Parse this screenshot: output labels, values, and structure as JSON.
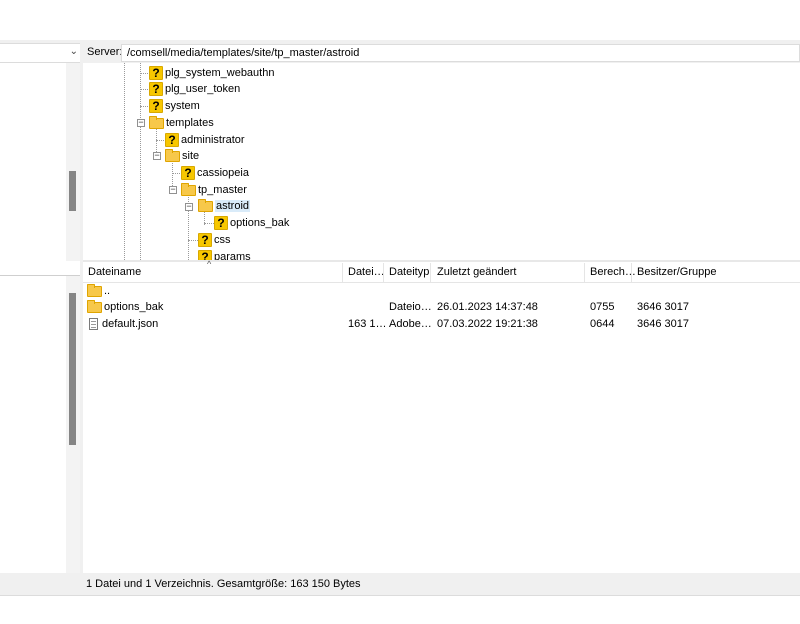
{
  "server": {
    "label": "Server:",
    "path": "/comsell/media/templates/site/tp_master/astroid"
  },
  "tree": {
    "nodes": [
      {
        "label": "plg_system_webauthn",
        "icon": "question-folder-icon"
      },
      {
        "label": "plg_user_token",
        "icon": "question-folder-icon"
      },
      {
        "label": "system",
        "icon": "question-folder-icon"
      },
      {
        "label": "templates",
        "icon": "folder-icon"
      },
      {
        "label": "administrator",
        "icon": "question-folder-icon"
      },
      {
        "label": "site",
        "icon": "folder-icon"
      },
      {
        "label": "cassiopeia",
        "icon": "question-folder-icon"
      },
      {
        "label": "tp_master",
        "icon": "folder-icon"
      },
      {
        "label": "astroid",
        "icon": "folder-icon"
      },
      {
        "label": "options_bak",
        "icon": "question-folder-icon"
      },
      {
        "label": "css",
        "icon": "question-folder-icon"
      },
      {
        "label": "params",
        "icon": "question-folder-icon"
      }
    ]
  },
  "list": {
    "columns": [
      "Dateiname",
      "Datei…",
      "Dateityp",
      "Zuletzt geändert",
      "Berech…",
      "Besitzer/Gruppe"
    ],
    "rows": [
      {
        "name": "..",
        "size": "",
        "type": "",
        "modified": "",
        "perms": "",
        "owner": "",
        "icon": "folder-icon"
      },
      {
        "name": "options_bak",
        "size": "",
        "type": "Dateio…",
        "modified": "26.01.2023 14:37:48",
        "perms": "0755",
        "owner": "3646 3017",
        "icon": "folder-icon"
      },
      {
        "name": "default.json",
        "size": "163 1…",
        "type": "Adobe…",
        "modified": "07.03.2022 19:21:38",
        "perms": "0644",
        "owner": "3646 3017",
        "icon": "file-icon"
      }
    ]
  },
  "status": {
    "text": "1 Datei und 1 Verzeichnis. Gesamtgröße: 163 150 Bytes"
  }
}
